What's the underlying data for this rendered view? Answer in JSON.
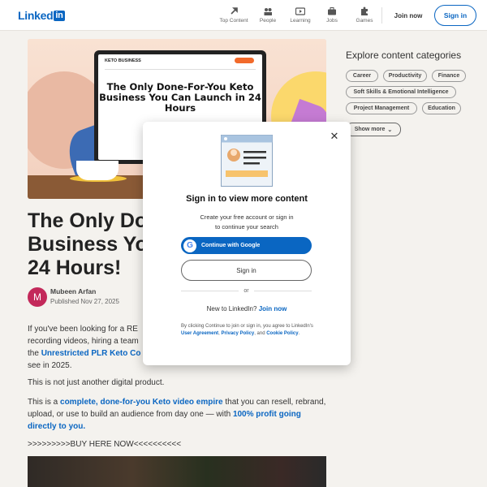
{
  "header": {
    "logo_text": "Linked",
    "logo_in": "in",
    "nav": [
      {
        "label": "Top Content",
        "icon": "rocket-icon"
      },
      {
        "label": "People",
        "icon": "people-icon"
      },
      {
        "label": "Learning",
        "icon": "video-icon"
      },
      {
        "label": "Jobs",
        "icon": "briefcase-icon"
      },
      {
        "label": "Games",
        "icon": "puzzle-icon"
      }
    ],
    "join_label": "Join now",
    "signin_label": "Sign in"
  },
  "article": {
    "hero": {
      "brand": "KETO BUSINESS",
      "headline": "The Only Done-For-You Keto Business You Can Launch in 24 Hours"
    },
    "title": "The Only Do… Business You… 24 Hours!",
    "title_lines": [
      "The Only Do",
      "Business You",
      "24 Hours!"
    ],
    "author_initial": "M",
    "author": "Mubeen Arfan",
    "published": "Published Nov 27, 2025",
    "p1_a": "If you've been looking for a RE",
    "p1_b": "recording videos, hiring a team",
    "p1_c_pre": "the ",
    "p1_c_link": "Unrestricted PLR Keto Co",
    "p1_d": "see in 2025.",
    "p2": "This is not just another digital product.",
    "p3_pre": "This is a ",
    "p3_link1": "complete, done-for-you Keto video empire",
    "p3_mid": " that you can resell, rebrand, upload, or use to build an audience from day one — with ",
    "p3_link2": "100% profit going directly to you.",
    "cta": ">>>>>>>>>BUY HERE NOW<<<<<<<<<<"
  },
  "sidebar": {
    "heading": "Explore content categories",
    "chips": [
      "Career",
      "Productivity",
      "Finance",
      "Soft Skills & Emotional Intelligence",
      "Project Management",
      "Education"
    ],
    "show_more": "Show more"
  },
  "modal": {
    "title": "Sign in to view more content",
    "subtitle_1": "Create your free account or sign in",
    "subtitle_2": "to continue your search",
    "google_label": "Continue with Google",
    "signin_label": "Sign in",
    "or": "or",
    "new_prefix": "New to LinkedIn? ",
    "join_link": "Join now",
    "legal_1": "By clicking Continue to join or sign in, you agree to LinkedIn's ",
    "legal_ua": "User Agreement",
    "legal_2": ", ",
    "legal_pp": "Privacy Policy",
    "legal_3": ", and ",
    "legal_cp": "Cookie Policy",
    "legal_4": "."
  },
  "colors": {
    "brand": "#0a66c2",
    "avatar": "#c3295a"
  }
}
